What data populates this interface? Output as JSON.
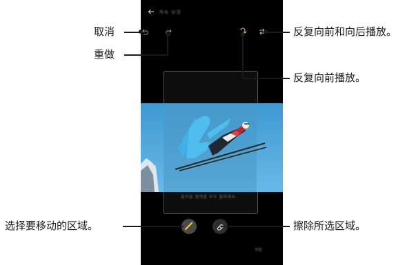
{
  "phone": {
    "title_blurred": "계속 보정",
    "caption_blurred": "움직일 영역을 모두 칠하세요.",
    "done_label": "저장"
  },
  "icons": {
    "back": "arrow-left-icon",
    "undo": "undo-icon",
    "redo": "redo-icon",
    "loop_forward": "loop-forward-icon",
    "loop_bounce": "loop-bounce-icon",
    "brush": "brush-icon",
    "eraser": "eraser-icon"
  },
  "annotations": {
    "undo": "取消",
    "redo": "重做",
    "loop_bounce": "反复向前和向后播放。",
    "loop_forward": "反复向前播放。",
    "select_area": "选择要移动的区域。",
    "erase_area": "擦除所选区域。"
  },
  "colors": {
    "sky": "#4aa3d8",
    "brush_stroke": "#3fa8e0",
    "accent": "#e8c93b"
  }
}
